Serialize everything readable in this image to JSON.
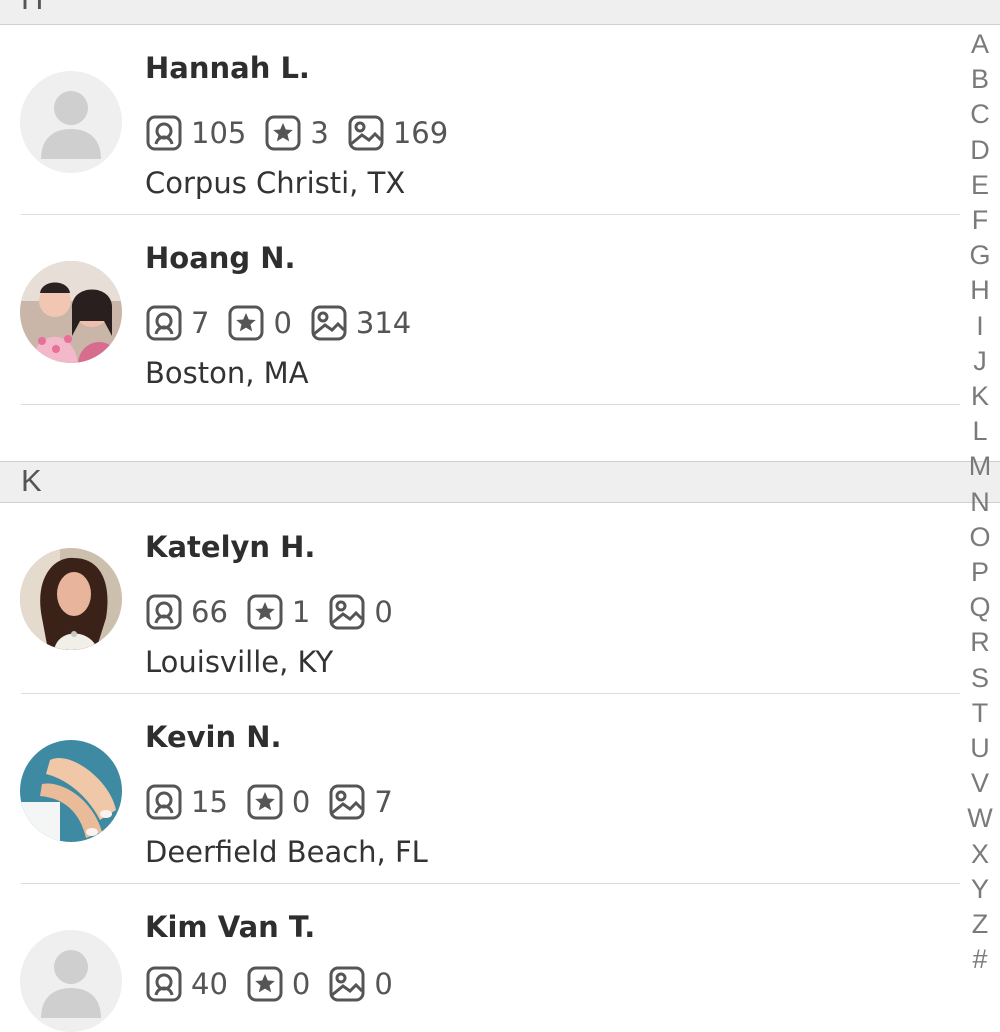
{
  "sections": [
    {
      "letter": "H"
    },
    {
      "letter": "K"
    }
  ],
  "contacts": [
    {
      "name": "Hannah L.",
      "reviews": "105",
      "ratings": "3",
      "photos": "169",
      "location": "Corpus Christi, TX",
      "avatar": "default-avatar"
    },
    {
      "name": "Hoang N.",
      "reviews": "7",
      "ratings": "0",
      "photos": "314",
      "location": "Boston, MA",
      "avatar": "photo"
    },
    {
      "name": "Katelyn H.",
      "reviews": "66",
      "ratings": "1",
      "photos": "0",
      "location": "Louisville, KY",
      "avatar": "photo"
    },
    {
      "name": "Kevin N.",
      "reviews": "15",
      "ratings": "0",
      "photos": "7",
      "location": "Deerfield Beach, FL",
      "avatar": "photo"
    },
    {
      "name": "Kim Van T.",
      "reviews": "40",
      "ratings": "0",
      "photos": "0",
      "location": "",
      "avatar": "default-avatar"
    }
  ],
  "index_letters": [
    "A",
    "B",
    "C",
    "D",
    "E",
    "F",
    "G",
    "H",
    "I",
    "J",
    "K",
    "L",
    "M",
    "N",
    "O",
    "P",
    "Q",
    "R",
    "S",
    "T",
    "U",
    "V",
    "W",
    "X",
    "Y",
    "Z",
    "#"
  ],
  "colors": {
    "header_bg": "#efefef",
    "divider": "#dcdcdc",
    "icon": "#555555",
    "index_text": "#7a7a7a"
  }
}
